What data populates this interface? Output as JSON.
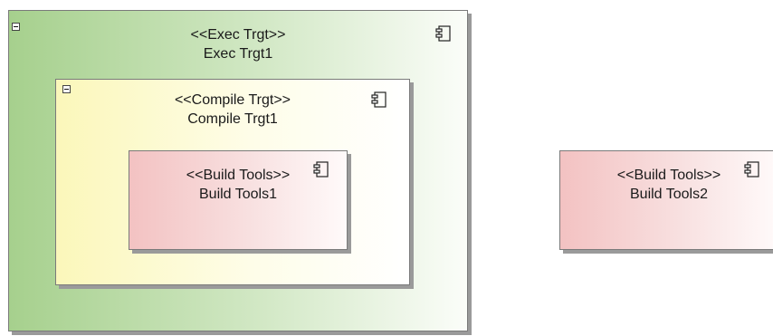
{
  "nodes": {
    "exec": {
      "stereotype": "<<Exec Trgt>>",
      "name": "Exec Trgt1"
    },
    "compile": {
      "stereotype": "<<Compile Trgt>>",
      "name": "Compile Trgt1"
    },
    "build1": {
      "stereotype": "<<Build Tools>>",
      "name": "Build Tools1"
    },
    "build2": {
      "stereotype": "<<Build Tools>>",
      "name": "Build Tools2"
    }
  },
  "icons": {
    "component": "component-icon",
    "collapse": "collapse-toggle-icon"
  },
  "colors": {
    "exec_fill": "#a6d08d",
    "compile_fill": "#fbf7ba",
    "build_fill": "#f3c2c2",
    "border": "#7a7a7a",
    "shadow": "#9a9a9a"
  }
}
